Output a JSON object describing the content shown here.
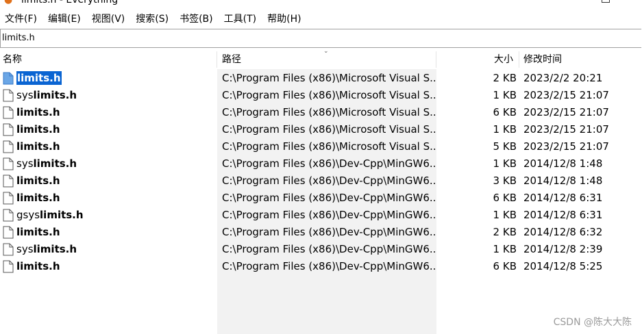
{
  "window": {
    "title": "limits.h - Everything"
  },
  "menu": [
    {
      "label": "文件(F)"
    },
    {
      "label": "编辑(E)"
    },
    {
      "label": "视图(V)"
    },
    {
      "label": "搜索(S)"
    },
    {
      "label": "书签(B)"
    },
    {
      "label": "工具(T)"
    },
    {
      "label": "帮助(H)"
    }
  ],
  "search": {
    "value": "limits.h"
  },
  "columns": {
    "name": "名称",
    "path": "路径",
    "size": "大小",
    "modified": "修改时间"
  },
  "rows": [
    {
      "prefix": "",
      "match": "limits.h",
      "path": "C:\\Program Files (x86)\\Microsoft Visual S...",
      "size": "2 KB",
      "modified": "2023/2/2 20:21",
      "selected": true,
      "icon": "file-icon-blue"
    },
    {
      "prefix": "sys",
      "match": "limits.h",
      "path": "C:\\Program Files (x86)\\Microsoft Visual S...",
      "size": "1 KB",
      "modified": "2023/2/15 21:07",
      "selected": false,
      "icon": "file-icon"
    },
    {
      "prefix": "",
      "match": "limits.h",
      "path": "C:\\Program Files (x86)\\Microsoft Visual S...",
      "size": "6 KB",
      "modified": "2023/2/15 21:07",
      "selected": false,
      "icon": "file-icon"
    },
    {
      "prefix": "",
      "match": "limits.h",
      "path": "C:\\Program Files (x86)\\Microsoft Visual S...",
      "size": "1 KB",
      "modified": "2023/2/15 21:07",
      "selected": false,
      "icon": "file-icon"
    },
    {
      "prefix": "",
      "match": "limits.h",
      "path": "C:\\Program Files (x86)\\Microsoft Visual S...",
      "size": "5 KB",
      "modified": "2023/2/15 21:07",
      "selected": false,
      "icon": "file-icon"
    },
    {
      "prefix": "sys",
      "match": "limits.h",
      "path": "C:\\Program Files (x86)\\Dev-Cpp\\MinGW6...",
      "size": "1 KB",
      "modified": "2014/12/8 1:48",
      "selected": false,
      "icon": "file-icon"
    },
    {
      "prefix": "",
      "match": "limits.h",
      "path": "C:\\Program Files (x86)\\Dev-Cpp\\MinGW6...",
      "size": "3 KB",
      "modified": "2014/12/8 1:48",
      "selected": false,
      "icon": "file-icon"
    },
    {
      "prefix": "",
      "match": "limits.h",
      "path": "C:\\Program Files (x86)\\Dev-Cpp\\MinGW6...",
      "size": "6 KB",
      "modified": "2014/12/8 6:31",
      "selected": false,
      "icon": "file-icon"
    },
    {
      "prefix": "gsys",
      "match": "limits.h",
      "path": "C:\\Program Files (x86)\\Dev-Cpp\\MinGW6...",
      "size": "1 KB",
      "modified": "2014/12/8 6:31",
      "selected": false,
      "icon": "file-icon"
    },
    {
      "prefix": "",
      "match": "limits.h",
      "path": "C:\\Program Files (x86)\\Dev-Cpp\\MinGW6...",
      "size": "2 KB",
      "modified": "2014/12/8 6:32",
      "selected": false,
      "icon": "file-icon"
    },
    {
      "prefix": "sys",
      "match": "limits.h",
      "path": "C:\\Program Files (x86)\\Dev-Cpp\\MinGW6...",
      "size": "1 KB",
      "modified": "2014/12/8 2:39",
      "selected": false,
      "icon": "file-icon"
    },
    {
      "prefix": "",
      "match": "limits.h",
      "path": "C:\\Program Files (x86)\\Dev-Cpp\\MinGW6...",
      "size": "6 KB",
      "modified": "2014/12/8 5:25",
      "selected": false,
      "icon": "file-icon"
    }
  ],
  "watermark": "CSDN @陈大大陈",
  "colors": {
    "selection": "#0a64d2",
    "path_column_shade": "#f2f2f2",
    "app_icon": "#e0701a"
  }
}
